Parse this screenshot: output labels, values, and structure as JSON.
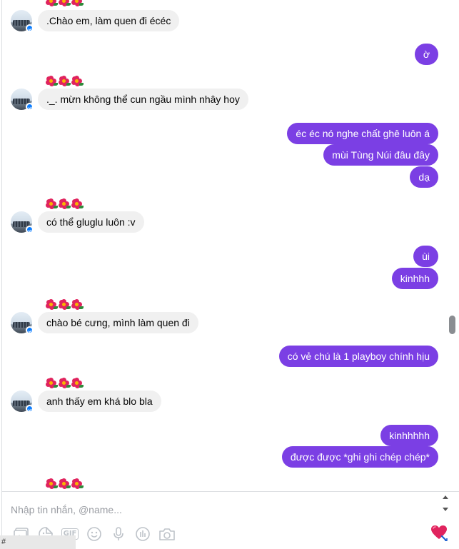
{
  "messages": [
    {
      "side": "in",
      "text": ".Chào em, làm quen đi écéc"
    },
    {
      "side": "out",
      "text": "ờ"
    },
    {
      "side": "in",
      "text": "._. mừn không thể cun ngầu mình nhây hoy"
    },
    {
      "side": "out",
      "text": "éc éc nó nghe chất ghê luôn á"
    },
    {
      "side": "out",
      "text": "mùi Tùng Núi đâu đây"
    },
    {
      "side": "out",
      "text": "dạ"
    },
    {
      "side": "in",
      "text": "có thể gluglu luôn :v"
    },
    {
      "side": "out",
      "text": "ùi"
    },
    {
      "side": "out",
      "text": "kinhhh"
    },
    {
      "side": "in",
      "text": "chào bé cưng, mình làm quen đi"
    },
    {
      "side": "out",
      "text": "có vẻ chú là 1 playboy chính hịu"
    },
    {
      "side": "in",
      "text": "anh thấy em khá blo bla"
    },
    {
      "side": "out",
      "text": "kinhhhhh"
    },
    {
      "side": "out",
      "text": "được được *ghi ghi chép chép*"
    }
  ],
  "composer": {
    "placeholder": "Nhập tin nhắn, @name..."
  },
  "toolbar": {
    "icons": [
      "photo-icon",
      "sticker-icon",
      "gif-icon",
      "emoji-icon",
      "microphone-icon",
      "poll-icon",
      "camera-icon"
    ],
    "gif_label": "GIF"
  },
  "reaction": {
    "icon": "heart-icon"
  },
  "status": {
    "text": "#"
  },
  "colors": {
    "outgoing": "#7b3fe4",
    "incoming": "#f0f0f0",
    "badge": "#0a7cff",
    "flower": "#e0245e"
  }
}
